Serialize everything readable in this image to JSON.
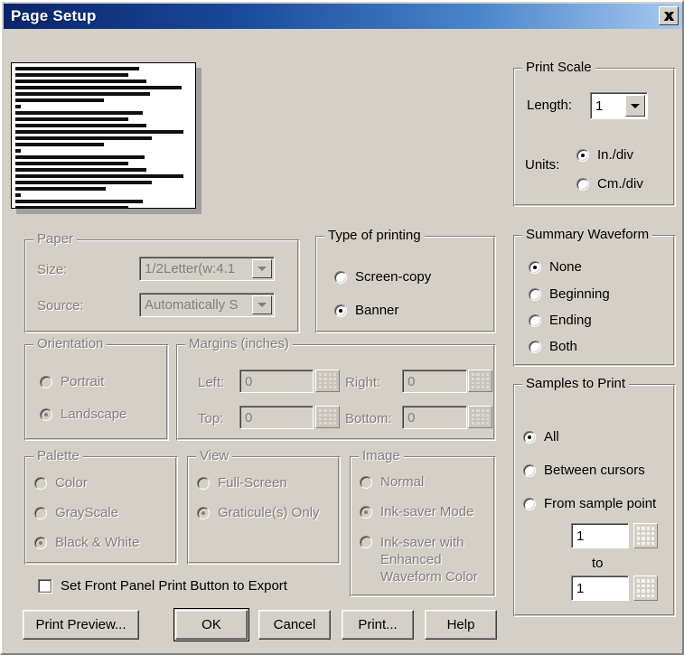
{
  "window": {
    "title": "Page Setup",
    "close_icon": "close-icon",
    "titlebar_color_left": "#0a246a",
    "titlebar_color_right": "#a6caf0",
    "face_color": "#d4d0c8"
  },
  "preview": {
    "name": "print-preview-thumbnail",
    "description": "Banner print preview showing repeated blocks of illegible dark text lines on a white page"
  },
  "print_scale": {
    "legend": "Print Scale",
    "length_label": "Length:",
    "length_value": "1",
    "units_label": "Units:",
    "units_options": [
      {
        "label": "In./div",
        "checked": true
      },
      {
        "label": "Cm./div",
        "checked": false
      }
    ]
  },
  "paper": {
    "legend": "Paper",
    "enabled": false,
    "size_label": "Size:",
    "size_value": "1/2Letter(w:4.1",
    "source_label": "Source:",
    "source_value": "Automatically S"
  },
  "type_of_printing": {
    "legend": "Type of printing",
    "options": [
      {
        "label": "Screen-copy",
        "checked": false
      },
      {
        "label": "Banner",
        "checked": true
      }
    ]
  },
  "summary_waveform": {
    "legend": "Summary Waveform",
    "options": [
      {
        "label": "None",
        "checked": true
      },
      {
        "label": "Beginning",
        "checked": false
      },
      {
        "label": "Ending",
        "checked": false
      },
      {
        "label": "Both",
        "checked": false
      }
    ]
  },
  "orientation": {
    "legend": "Orientation",
    "enabled": false,
    "options": [
      {
        "label": "Portrait",
        "checked": false
      },
      {
        "label": "Landscape",
        "checked": true
      }
    ]
  },
  "margins": {
    "legend": "Margins (inches)",
    "enabled": false,
    "left_label": "Left:",
    "left_value": "0",
    "right_label": "Right:",
    "right_value": "0",
    "top_label": "Top:",
    "top_value": "0",
    "bottom_label": "Bottom:",
    "bottom_value": "0"
  },
  "palette": {
    "legend": "Palette",
    "enabled": false,
    "options": [
      {
        "label": "Color",
        "checked": false
      },
      {
        "label": "GrayScale",
        "checked": false
      },
      {
        "label": "Black & White",
        "checked": true
      }
    ]
  },
  "view": {
    "legend": "View",
    "enabled": false,
    "options": [
      {
        "label": "Full-Screen",
        "checked": false
      },
      {
        "label": "Graticule(s) Only",
        "checked": true
      }
    ]
  },
  "image": {
    "legend": "Image",
    "enabled": false,
    "options": [
      {
        "label": "Normal",
        "checked": false
      },
      {
        "label": "Ink-saver Mode",
        "checked": true
      },
      {
        "label": "Ink-saver with Enhanced Waveform Color",
        "checked": false
      }
    ]
  },
  "samples_to_print": {
    "legend": "Samples to Print",
    "options": [
      {
        "label": "All",
        "checked": true
      },
      {
        "label": "Between cursors",
        "checked": false
      },
      {
        "label": "From sample point",
        "checked": false
      }
    ],
    "from_value": "1",
    "to_label": "to",
    "to_value": "1"
  },
  "front_panel_checkbox": {
    "label": "Set Front Panel Print Button to Export",
    "checked": false
  },
  "buttons": {
    "print_preview": "Print Preview...",
    "ok": "OK",
    "cancel": "Cancel",
    "print": "Print...",
    "help": "Help"
  }
}
